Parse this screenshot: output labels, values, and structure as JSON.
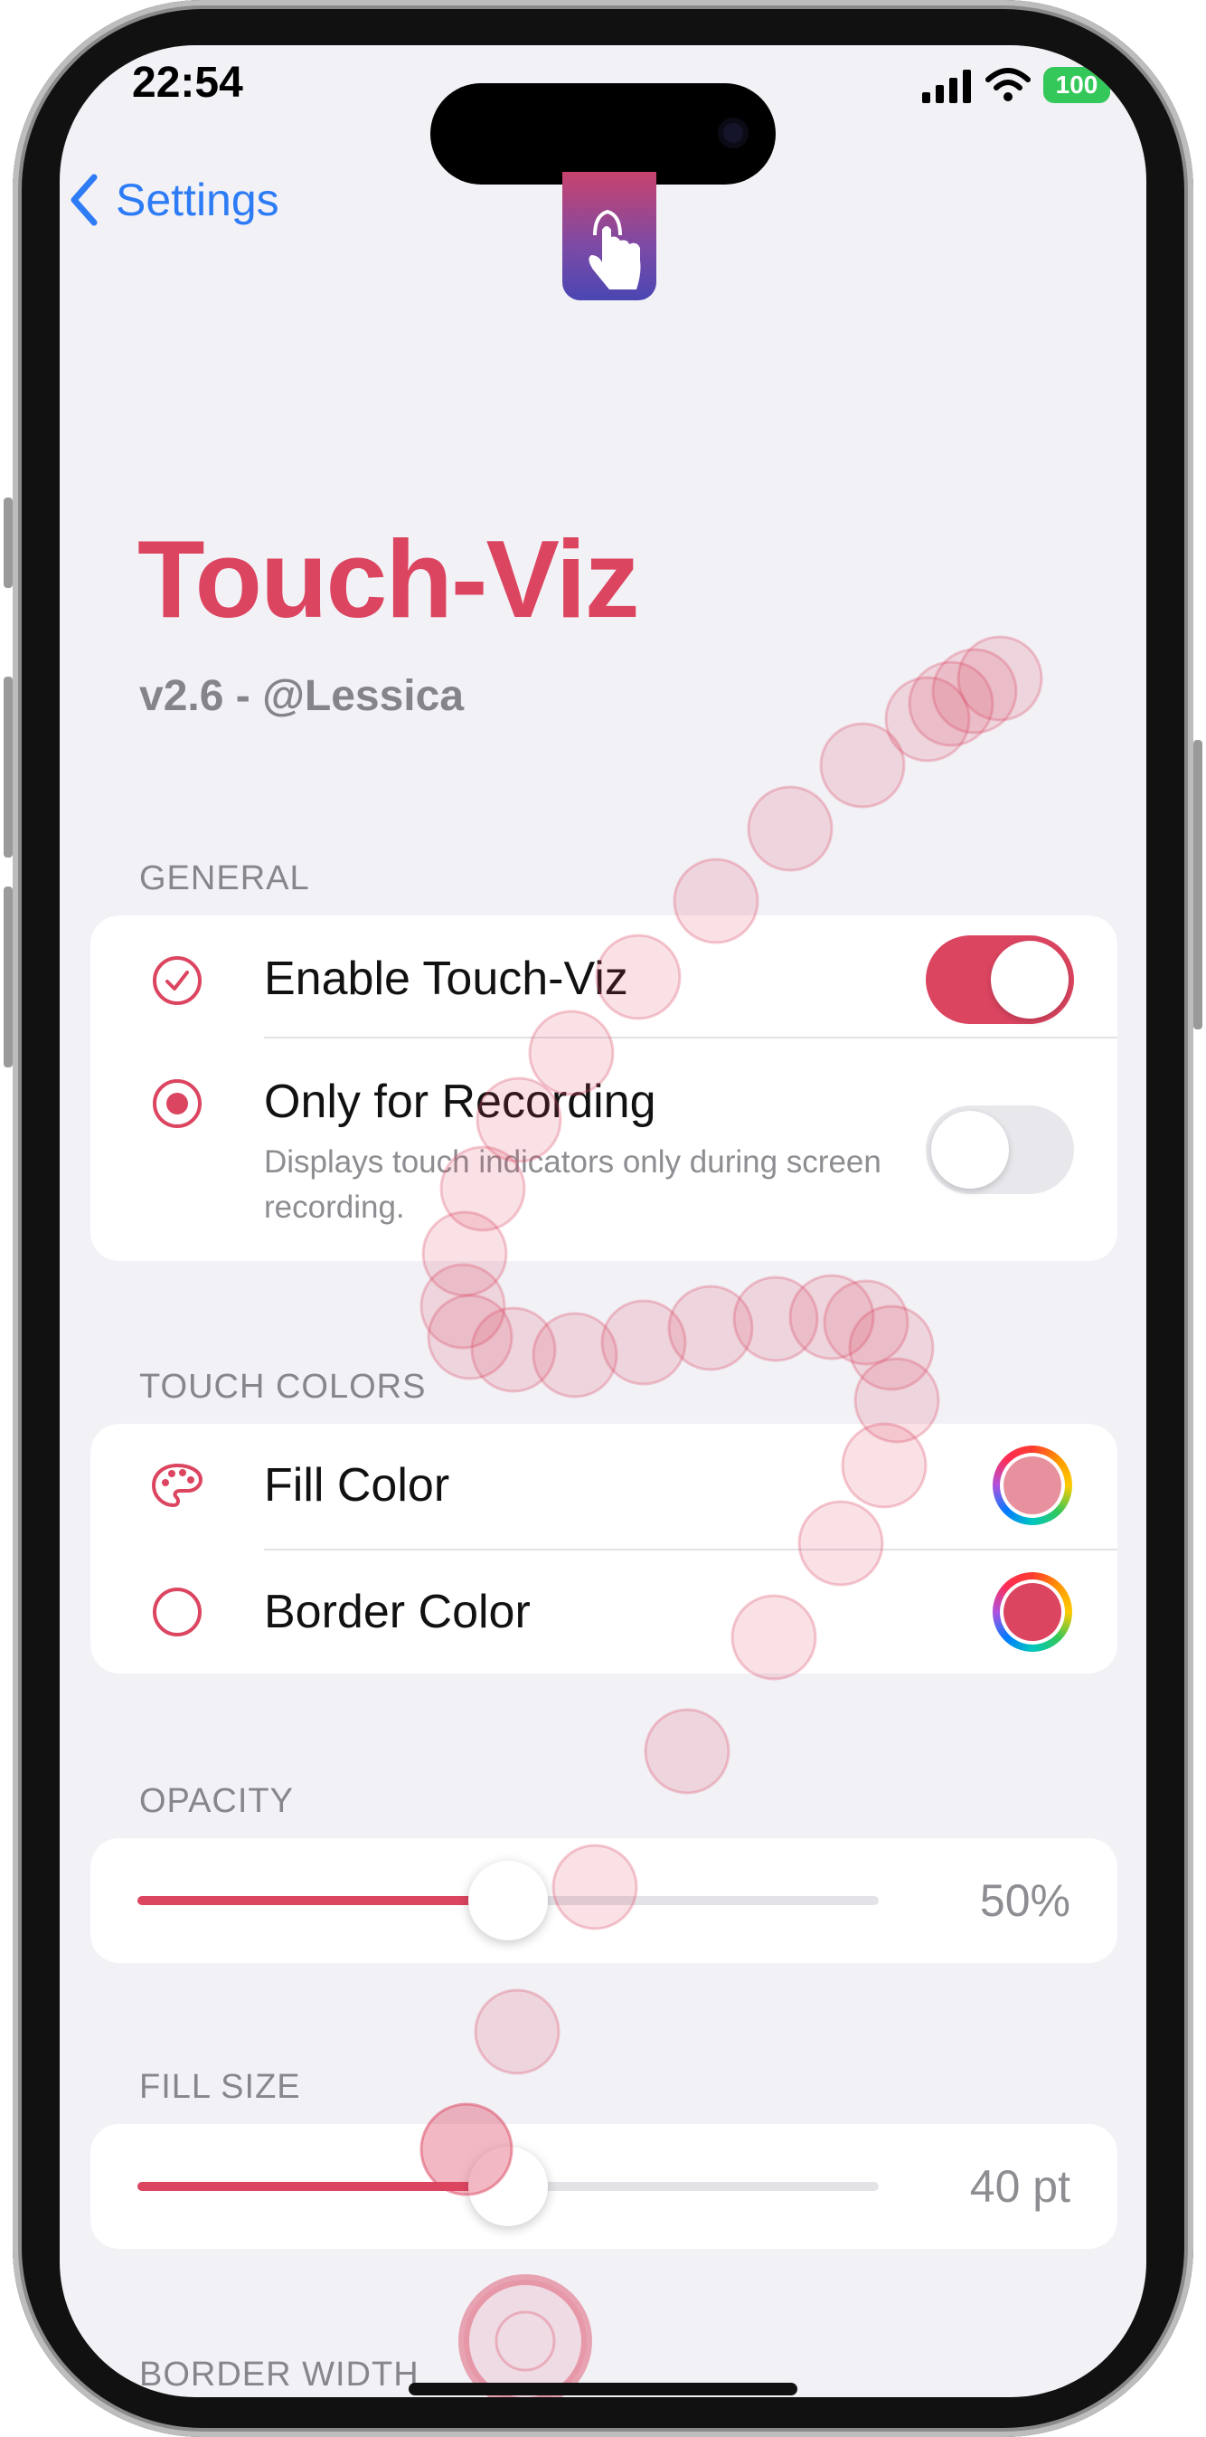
{
  "status_bar": {
    "time": "22:54",
    "battery": "100"
  },
  "nav": {
    "back_label": "Settings"
  },
  "header": {
    "title": "Touch-Viz",
    "subtitle": "v2.6 - @Lessica"
  },
  "sections": {
    "general": {
      "title": "GENERAL",
      "rows": [
        {
          "label": "Enable Touch-Viz",
          "enabled": true
        },
        {
          "label": "Only for Recording",
          "description": "Displays touch indicators only during screen recording.",
          "enabled": false
        }
      ]
    },
    "touch_colors": {
      "title": "TOUCH COLORS",
      "rows": [
        {
          "label": "Fill Color",
          "color": "#e8919e"
        },
        {
          "label": "Border Color",
          "color": "#dc4560"
        }
      ]
    },
    "opacity": {
      "title": "OPACITY",
      "value_text": "50%",
      "fraction": 0.5
    },
    "fill_size": {
      "title": "FILL SIZE",
      "value_text": "40 pt",
      "fraction": 0.5
    },
    "border_width": {
      "title": "BORDER WIDTH"
    }
  },
  "colors": {
    "accent": "#dc4560",
    "link": "#2d7cf6",
    "background": "#f2f1f6"
  }
}
